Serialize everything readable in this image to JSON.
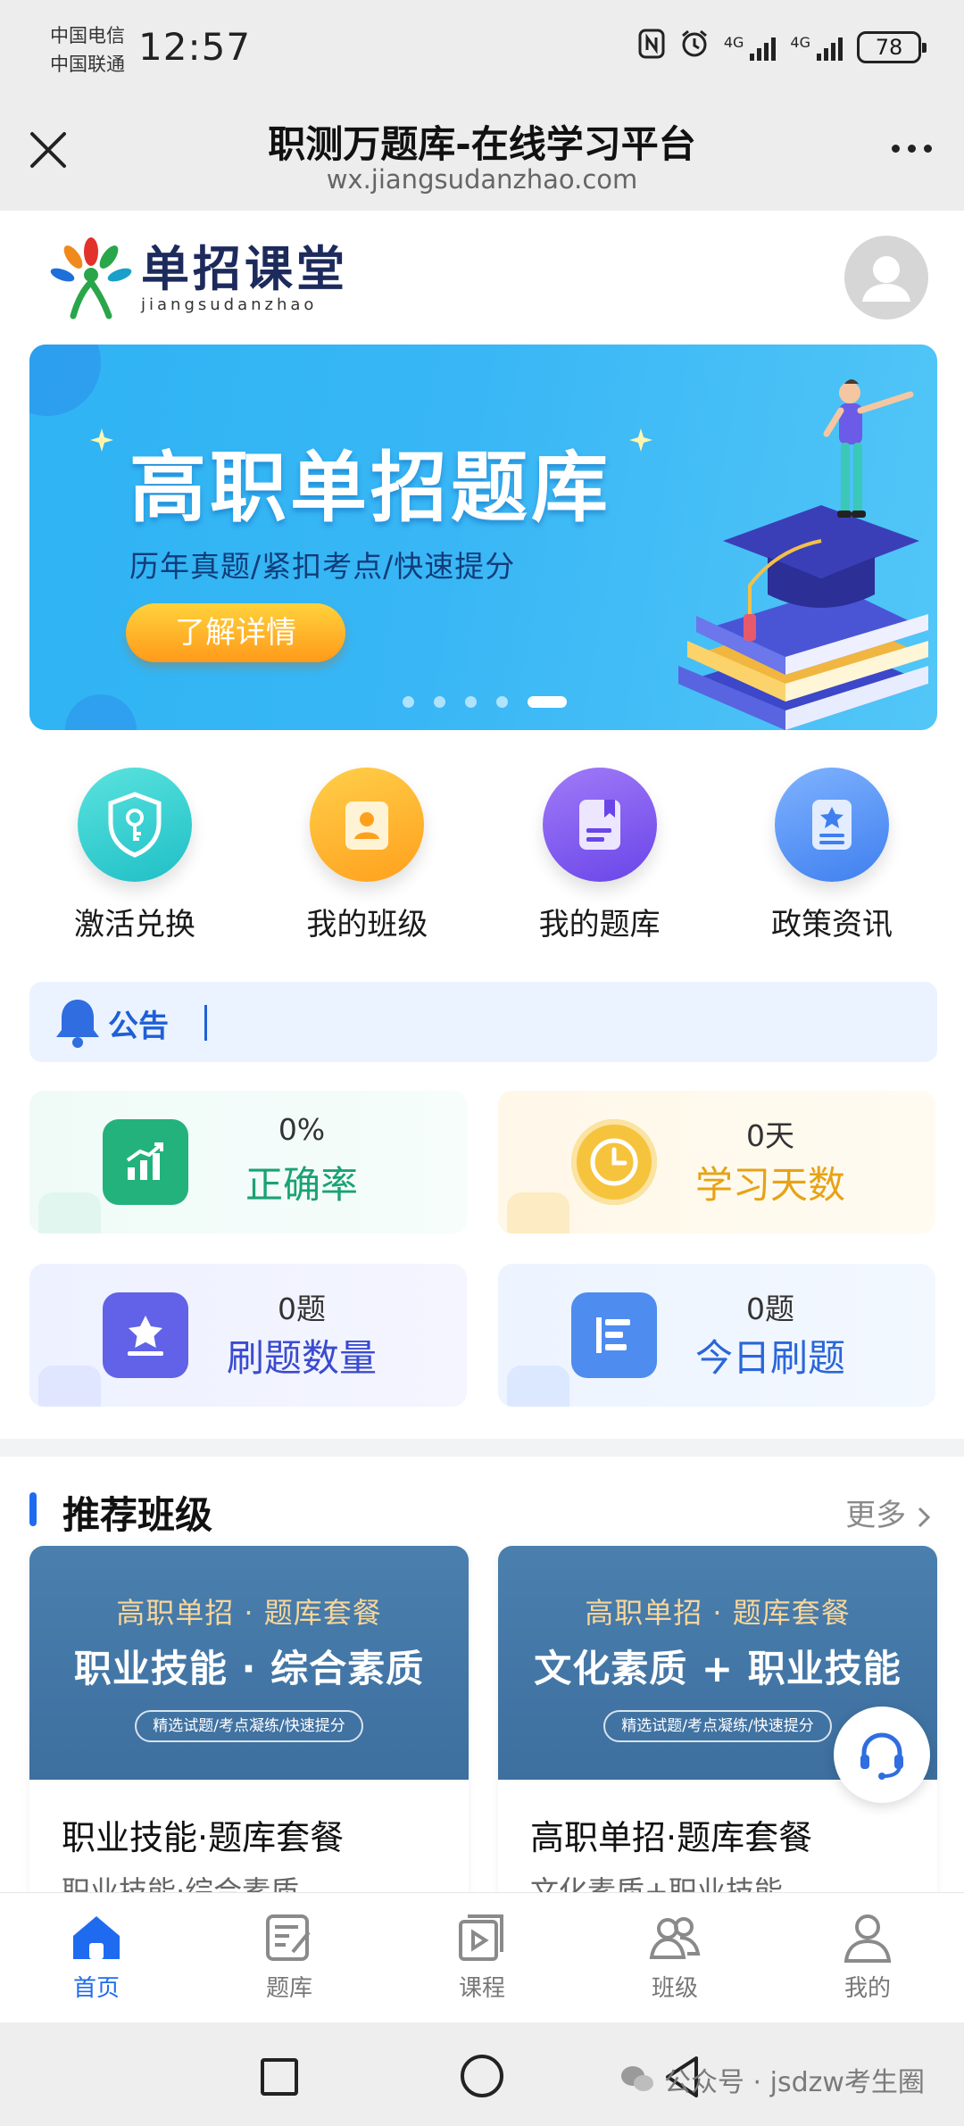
{
  "status_bar": {
    "carrier_1": "中国电信",
    "carrier_2": "中国联通",
    "time": "12:57",
    "network_1": "4G",
    "network_2": "4G",
    "battery": "78"
  },
  "browser": {
    "title": "职测万题库-在线学习平台",
    "url": "wx.jiangsudanzhao.com"
  },
  "logo": {
    "name_cn": "单招课堂",
    "name_en": "jiangsudanzhao"
  },
  "banner": {
    "title": "高职单招题库",
    "subtitle": "历年真题/紧扣考点/快速提分",
    "button": "了解详情",
    "page_count": 5,
    "active_page": 5
  },
  "shortcuts": [
    {
      "label": "激活兑换",
      "icon": "key-shield-icon",
      "color": "#1fc9c9"
    },
    {
      "label": "我的班级",
      "icon": "class-badge-icon",
      "color": "#ffad22"
    },
    {
      "label": "我的题库",
      "icon": "question-bank-icon",
      "color": "#7b5cf0"
    },
    {
      "label": "政策资讯",
      "icon": "policy-news-icon",
      "color": "#4d8ef5"
    }
  ],
  "notice": {
    "label": "公告"
  },
  "stats": {
    "accuracy": {
      "value": "0%",
      "label": "正确率"
    },
    "study_days": {
      "value": "0天",
      "label": "学习天数"
    },
    "question_count": {
      "value": "0题",
      "label": "刷题数量"
    },
    "today_questions": {
      "value": "0题",
      "label": "今日刷题"
    }
  },
  "recommend": {
    "title": "推荐班级",
    "more": "更多",
    "courses": [
      {
        "cover_top": "高职单招 · 题库套餐",
        "cover_main": "职业技能 · 综合素质",
        "cover_tag": "精选试题/考点凝练/快速提分",
        "title": "职业技能·题库套餐",
        "subtitle": "职业技能·综合素质"
      },
      {
        "cover_top": "高职单招 · 题库套餐",
        "cover_main": "文化素质 + 职业技能",
        "cover_tag": "精选试题/考点凝练/快速提分",
        "title": "高职单招·题库套餐",
        "subtitle": "文化素质+职业技能"
      }
    ]
  },
  "tabbar": [
    {
      "label": "首页",
      "icon": "home-icon",
      "active": true
    },
    {
      "label": "题库",
      "icon": "question-bank-icon",
      "active": false
    },
    {
      "label": "课程",
      "icon": "course-play-icon",
      "active": false
    },
    {
      "label": "班级",
      "icon": "class-group-icon",
      "active": false
    },
    {
      "label": "我的",
      "icon": "profile-icon",
      "active": false
    }
  ],
  "watermark": "公众号 · jsdzw考生圈",
  "colors": {
    "primary": "#1f6bf0",
    "banner": "#38b6f5",
    "accuracy": "#1aa272",
    "study_days": "#e6a316",
    "question_count": "#3a4bd0",
    "today_questions": "#2b66d8"
  }
}
